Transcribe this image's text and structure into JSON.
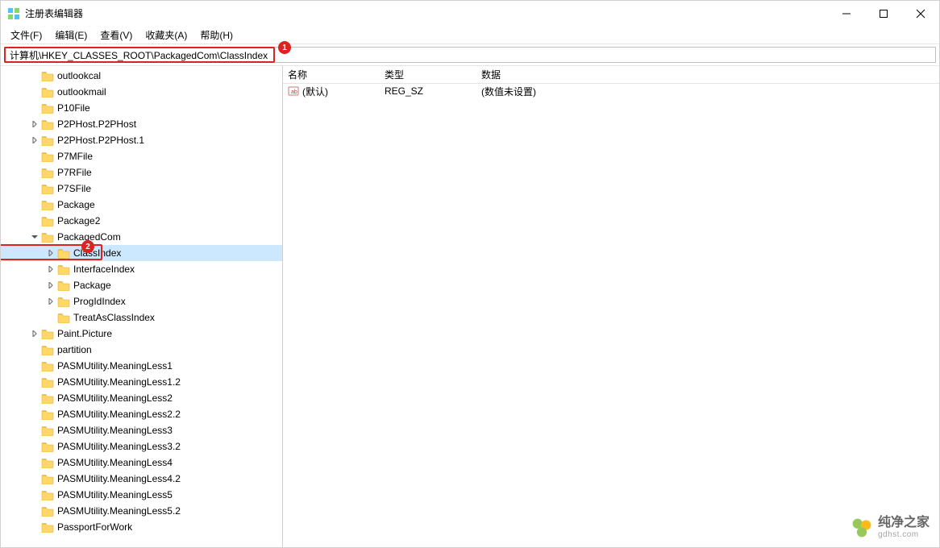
{
  "window": {
    "title": "注册表编辑器"
  },
  "menus": {
    "file": "文件(F)",
    "edit": "编辑(E)",
    "view": "查看(V)",
    "favorites": "收藏夹(A)",
    "help": "帮助(H)"
  },
  "address": {
    "path": "计算机\\HKEY_CLASSES_ROOT\\PackagedCom\\ClassIndex"
  },
  "annotations": {
    "badge1": "1",
    "badge2": "2"
  },
  "tree": {
    "items": [
      {
        "label": "outlookcal",
        "indent": 36,
        "expander": ""
      },
      {
        "label": "outlookmail",
        "indent": 36,
        "expander": ""
      },
      {
        "label": "P10File",
        "indent": 36,
        "expander": ""
      },
      {
        "label": "P2PHost.P2PHost",
        "indent": 36,
        "expander": "right"
      },
      {
        "label": "P2PHost.P2PHost.1",
        "indent": 36,
        "expander": "right"
      },
      {
        "label": "P7MFile",
        "indent": 36,
        "expander": ""
      },
      {
        "label": "P7RFile",
        "indent": 36,
        "expander": ""
      },
      {
        "label": "P7SFile",
        "indent": 36,
        "expander": ""
      },
      {
        "label": "Package",
        "indent": 36,
        "expander": ""
      },
      {
        "label": "Package2",
        "indent": 36,
        "expander": ""
      },
      {
        "label": "PackagedCom",
        "indent": 36,
        "expander": "down"
      },
      {
        "label": "ClassIndex",
        "indent": 56,
        "expander": "right",
        "selected": true
      },
      {
        "label": "InterfaceIndex",
        "indent": 56,
        "expander": "right"
      },
      {
        "label": "Package",
        "indent": 56,
        "expander": "right"
      },
      {
        "label": "ProgIdIndex",
        "indent": 56,
        "expander": "right"
      },
      {
        "label": "TreatAsClassIndex",
        "indent": 56,
        "expander": ""
      },
      {
        "label": "Paint.Picture",
        "indent": 36,
        "expander": "right"
      },
      {
        "label": "partition",
        "indent": 36,
        "expander": ""
      },
      {
        "label": "PASMUtility.MeaningLess1",
        "indent": 36,
        "expander": ""
      },
      {
        "label": "PASMUtility.MeaningLess1.2",
        "indent": 36,
        "expander": ""
      },
      {
        "label": "PASMUtility.MeaningLess2",
        "indent": 36,
        "expander": ""
      },
      {
        "label": "PASMUtility.MeaningLess2.2",
        "indent": 36,
        "expander": ""
      },
      {
        "label": "PASMUtility.MeaningLess3",
        "indent": 36,
        "expander": ""
      },
      {
        "label": "PASMUtility.MeaningLess3.2",
        "indent": 36,
        "expander": ""
      },
      {
        "label": "PASMUtility.MeaningLess4",
        "indent": 36,
        "expander": ""
      },
      {
        "label": "PASMUtility.MeaningLess4.2",
        "indent": 36,
        "expander": ""
      },
      {
        "label": "PASMUtility.MeaningLess5",
        "indent": 36,
        "expander": ""
      },
      {
        "label": "PASMUtility.MeaningLess5.2",
        "indent": 36,
        "expander": ""
      },
      {
        "label": "PassportForWork",
        "indent": 36,
        "expander": ""
      }
    ]
  },
  "list": {
    "headers": {
      "name": "名称",
      "type": "类型",
      "data": "数据"
    },
    "rows": [
      {
        "name": "(默认)",
        "type": "REG_SZ",
        "data": "(数值未设置)"
      }
    ]
  },
  "watermark": {
    "main": "纯净之家",
    "sub": "gdhst.com"
  }
}
